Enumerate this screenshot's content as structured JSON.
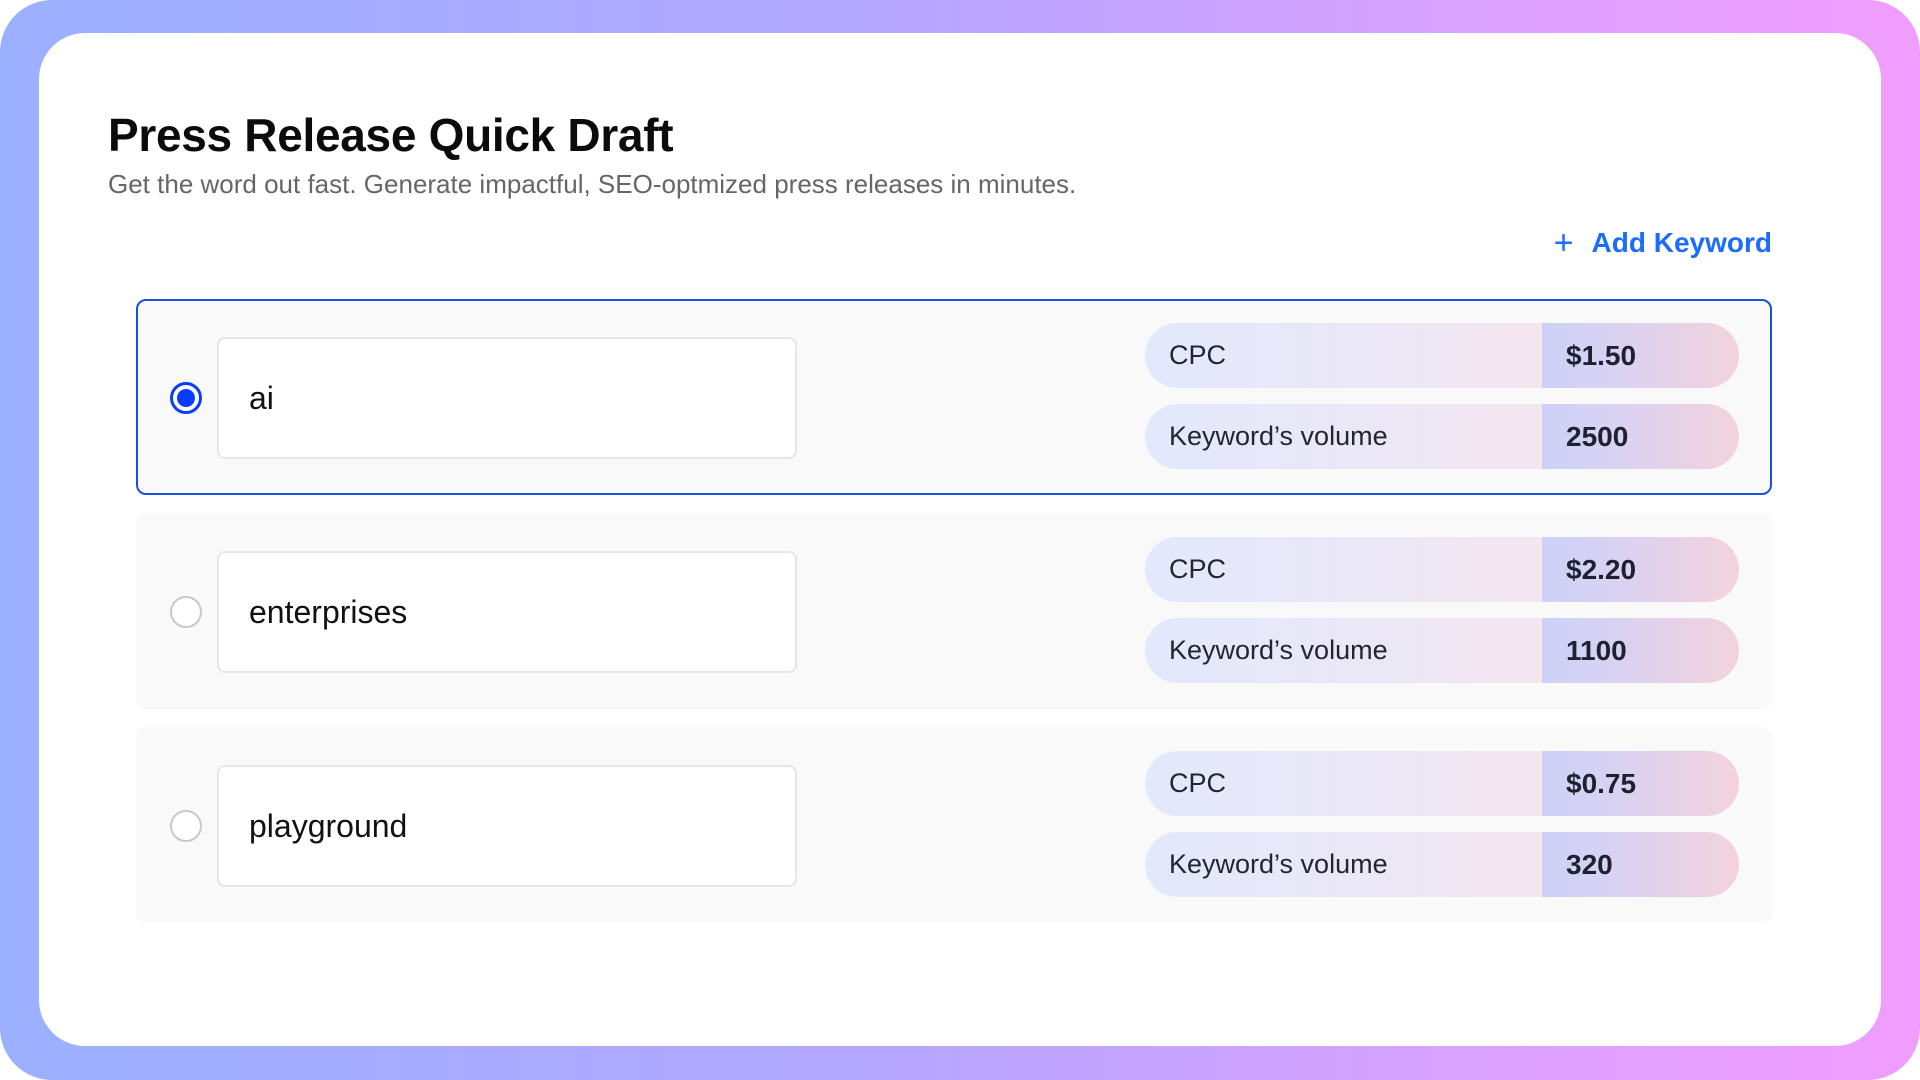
{
  "header": {
    "title": "Press Release Quick Draft",
    "subtitle": "Get the word out fast. Generate impactful, SEO-optmized press releases in minutes."
  },
  "actions": {
    "add_keyword_icon": "plus-icon",
    "add_keyword_label": "Add Keyword"
  },
  "keywords": [
    {
      "value": "ai",
      "selected": true,
      "metrics": [
        {
          "label": "CPC",
          "value": "$1.50"
        },
        {
          "label": "Keyword’s volume",
          "value": "2500"
        }
      ]
    },
    {
      "value": "enterprises",
      "selected": false,
      "metrics": [
        {
          "label": "CPC",
          "value": "$2.20"
        },
        {
          "label": "Keyword’s volume",
          "value": "1100"
        }
      ]
    },
    {
      "value": "playground",
      "selected": false,
      "metrics": [
        {
          "label": "CPC",
          "value": "$0.75"
        },
        {
          "label": "Keyword’s volume",
          "value": "320"
        }
      ]
    }
  ],
  "colors": {
    "accent": "#1a6dff",
    "selected_border": "#1a4fe0",
    "radio_active": "#0a3cff",
    "frame_gradient_start": "#9bb0ff",
    "frame_gradient_end": "#f19dff"
  }
}
